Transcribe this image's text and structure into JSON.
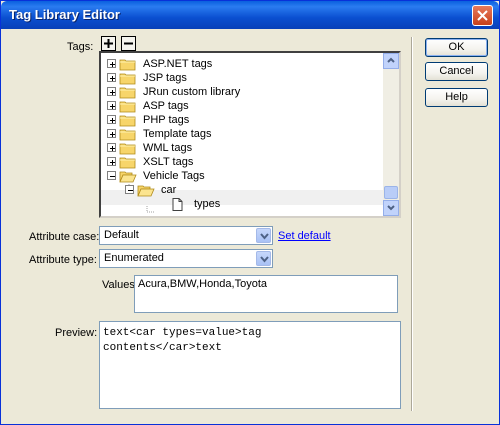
{
  "window": {
    "title": "Tag Library Editor"
  },
  "tags": {
    "label": "Tags:",
    "tree": [
      {
        "label": "ASP.NET tags",
        "level": 0,
        "expanded": false
      },
      {
        "label": "JSP tags",
        "level": 0,
        "expanded": false
      },
      {
        "label": "JRun custom library",
        "level": 0,
        "expanded": false
      },
      {
        "label": "ASP tags",
        "level": 0,
        "expanded": false
      },
      {
        "label": "PHP tags",
        "level": 0,
        "expanded": false
      },
      {
        "label": "Template tags",
        "level": 0,
        "expanded": false
      },
      {
        "label": "WML tags",
        "level": 0,
        "expanded": false
      },
      {
        "label": "XSLT tags",
        "level": 0,
        "expanded": false
      },
      {
        "label": "Vehicle Tags",
        "level": 0,
        "expanded": true
      },
      {
        "label": "car",
        "level": 1,
        "expanded": true
      },
      {
        "label": "types",
        "level": 2,
        "selected": true
      }
    ]
  },
  "attribute_case": {
    "label": "Attribute case:",
    "value": "Default",
    "link": "Set default"
  },
  "attribute_type": {
    "label": "Attribute type:",
    "value": "Enumerated"
  },
  "values": {
    "label": "Values:",
    "value": "Acura,BMW,Honda,Toyota"
  },
  "preview": {
    "label": "Preview:",
    "text": "text<car types=value>tag\ncontents</car>text"
  },
  "buttons": {
    "ok": "OK",
    "cancel": "Cancel",
    "help": "Help"
  }
}
